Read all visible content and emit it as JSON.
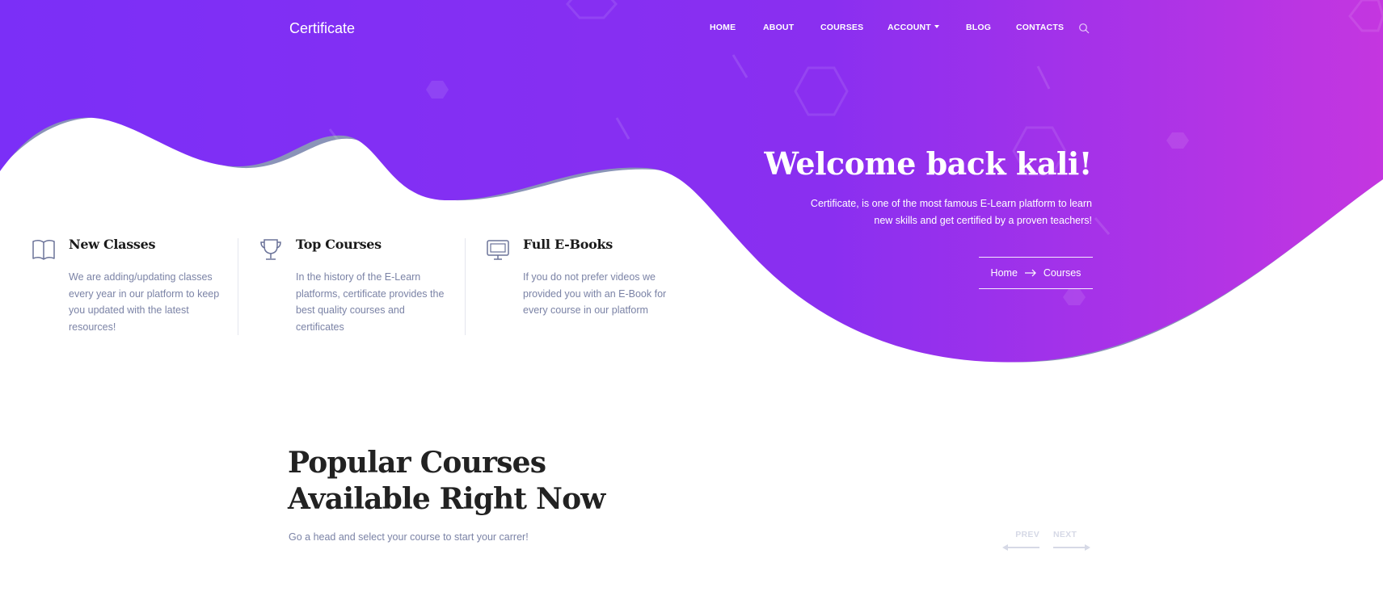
{
  "brand": {
    "name": "Certificate"
  },
  "nav": {
    "items": [
      {
        "label": "HOME"
      },
      {
        "label": "ABOUT"
      },
      {
        "label": "COURSES"
      },
      {
        "label": "ACCOUNT"
      },
      {
        "label": "BLOG"
      },
      {
        "label": "CONTACTS"
      }
    ],
    "search_icon": "search-icon"
  },
  "hero": {
    "title": "Welcome back kali!",
    "description": "Certificate, is one of the most famous E-Learn platform to learn new skills and get certified by a proven teachers!",
    "breadcrumb": {
      "home": "Home",
      "current": "Courses",
      "separator_icon": "arrow-right-icon"
    },
    "gradient": {
      "start": "#7b2ff7",
      "end": "#c436e0"
    }
  },
  "features": [
    {
      "icon": "book-icon",
      "title": "New Classes",
      "text": "We are adding/updating classes every year in our platform to keep you updated with the latest resources!"
    },
    {
      "icon": "trophy-icon",
      "title": "Top Courses",
      "text": "In the history of the E-Learn platforms, certificate provides the best quality courses and certificates"
    },
    {
      "icon": "monitor-icon",
      "title": "Full E-Books",
      "text": "If you do not prefer videos we provided you with an E-Book for every course in our platform"
    }
  ],
  "popular": {
    "title_line1": "Popular Courses",
    "title_line2": "Available Right Now",
    "subtitle": "Go a head and select your course to start your carrer!",
    "prev_label": "PREV",
    "next_label": "NEXT"
  },
  "colors": {
    "muted_text": "#7b83a6",
    "heading": "#222222",
    "shadow_wave": "#8a94b8"
  }
}
